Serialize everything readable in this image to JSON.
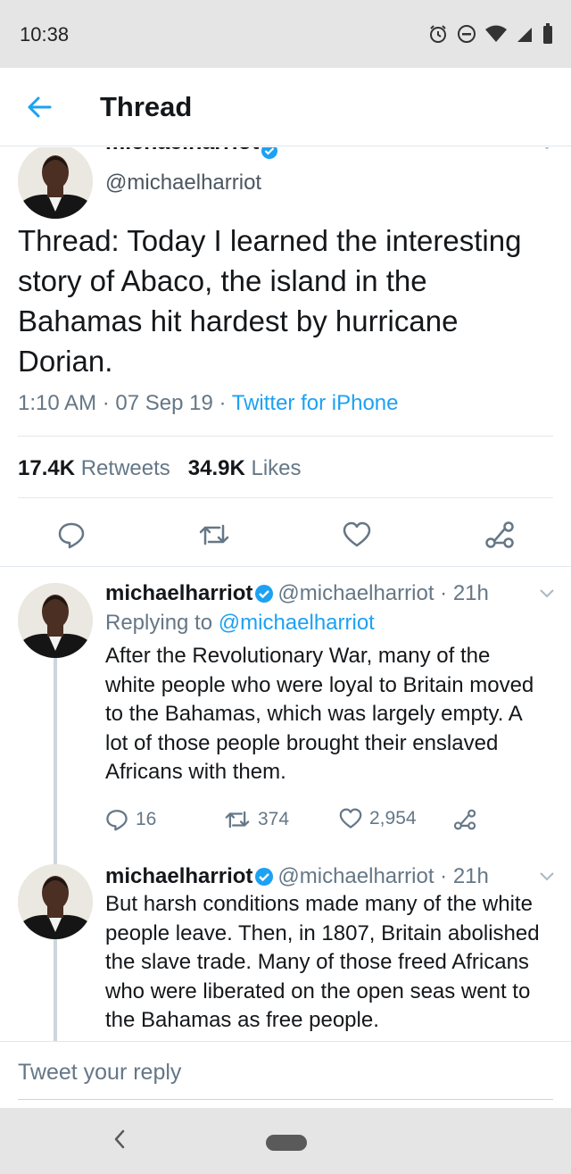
{
  "status_bar": {
    "time": "10:38",
    "icons": [
      "alarm-icon",
      "do-not-disturb-icon",
      "wifi-icon",
      "signal-icon",
      "battery-icon"
    ]
  },
  "header": {
    "title": "Thread",
    "back_icon": "back-arrow-icon"
  },
  "main_tweet": {
    "name_cut": "michaelharriot",
    "handle": "@michaelharriot",
    "text": "Thread: Today I learned the interesting story of Abaco, the island in the Bahamas hit hardest by hurricane Dorian.",
    "time": "1:10 AM",
    "date": "07 Sep 19",
    "source": "Twitter for iPhone",
    "separator": "·",
    "retweets_count": "17.4K",
    "retweets_label": "Retweets",
    "likes_count": "34.9K",
    "likes_label": "Likes",
    "actions": [
      "reply-icon",
      "retweet-icon",
      "like-icon",
      "share-icon"
    ]
  },
  "replies": [
    {
      "name": "michaelharriot",
      "handle": "@michaelharriot",
      "age": "· 21h",
      "replying_prefix": "Replying to",
      "replying_to": "@michaelharriot",
      "lines": [
        "After the Revolutionary War, many of the",
        "white people who were loyal to Britain moved",
        "to the Bahamas, which was largely empty. A",
        "lot of those people brought their enslaved",
        "Africans with them."
      ],
      "reply_count": "16",
      "retweet_count": "374",
      "like_count": "2,954"
    },
    {
      "name": "michaelharriot",
      "handle": "@michaelharriot",
      "age": "· 21h",
      "lines": [
        "But harsh conditions made many of the white",
        "people leave. Then, in 1807, Britain abolished",
        "the slave trade. Many of those freed Africans",
        "who were liberated on the open seas went to",
        "the Bahamas as free people."
      ]
    }
  ],
  "reply_bar": {
    "placeholder": "Tweet your reply"
  },
  "nav": {
    "back_label": "‹"
  },
  "colors": {
    "accent": "#1da1f2",
    "text": "#14171a",
    "secondary": "#657786",
    "divider": "#e1e8ed"
  }
}
